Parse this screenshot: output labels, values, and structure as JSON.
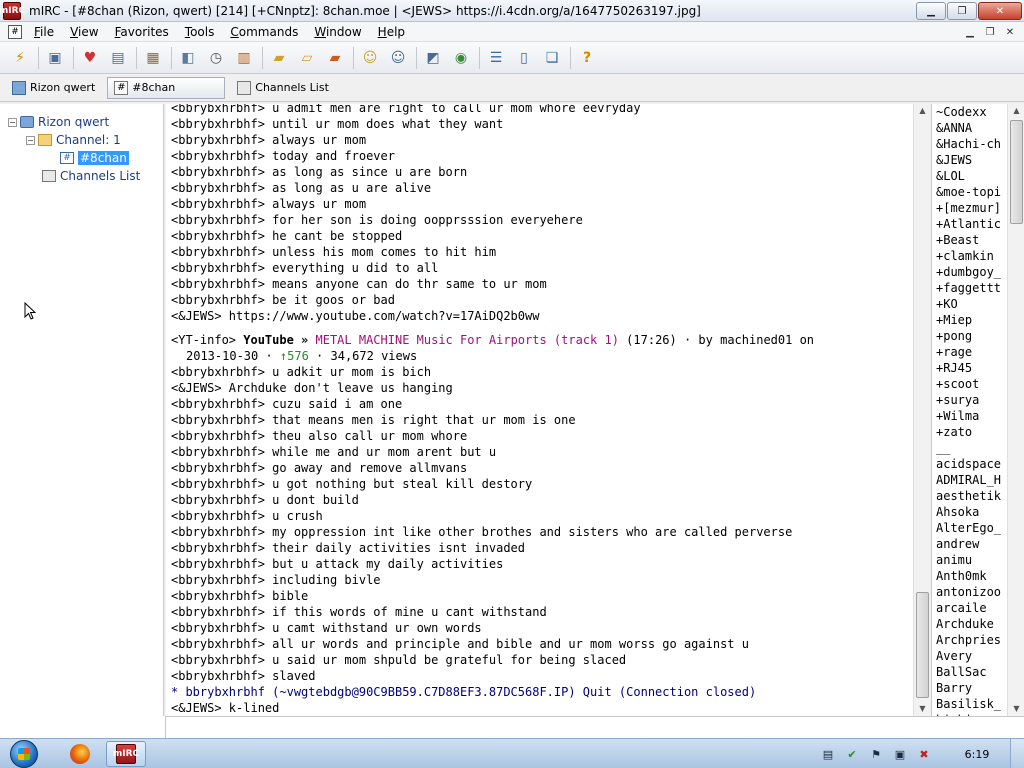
{
  "window": {
    "title": "mIRC - [#8chan (Rizon, qwert) [214] [+CNnptz]: 8chan.moe | <JEWS> https://i.4cdn.org/a/1647750263197.jpg]",
    "app_icon_text": "mIRC"
  },
  "menu": {
    "icon": "#",
    "items": [
      {
        "accel": "F",
        "rest": "ile"
      },
      {
        "accel": "V",
        "rest": "iew"
      },
      {
        "accel": "F",
        "rest": "avorites"
      },
      {
        "accel": "T",
        "rest": "ools"
      },
      {
        "accel": "C",
        "rest": "ommands"
      },
      {
        "accel": "W",
        "rest": "indow"
      },
      {
        "accel": "H",
        "rest": "elp"
      }
    ]
  },
  "switchbar": {
    "tabs": [
      {
        "label": "Rizon qwert",
        "icon": "network-icon"
      },
      {
        "label": "#8chan",
        "icon": "channel-icon",
        "active": true
      },
      {
        "label": "Channels List",
        "icon": "list-icon"
      }
    ]
  },
  "tree": {
    "network": "Rizon qwert",
    "folder": "Channel: 1",
    "channel": "#8chan",
    "channels_list": "Channels List",
    "chan_icon_glyph": "#"
  },
  "chat": {
    "lines": [
      "<bbrybxhrbhf> u admit men are right to call ur mom whore eevryday",
      "<bbrybxhrbhf> until ur mom does what they want",
      "<bbrybxhrbhf> always ur mom",
      "<bbrybxhrbhf> today and froever",
      "<bbrybxhrbhf> as long as since u are born",
      "<bbrybxhrbhf> as long as u are alive",
      "<bbrybxhrbhf> always ur mom",
      "<bbrybxhrbhf> for her son is doing oopprsssion everyehere",
      "<bbrybxhrbhf> he cant be stopped",
      "<bbrybxhrbhf> unless his mom comes to hit him",
      "<bbrybxhrbhf> everything u did to all",
      "<bbrybxhrbhf> means anyone can do thr same to ur mom",
      "<bbrybxhrbhf> be it goos or bad",
      "<&JEWS> https://www.youtube.com/watch?v=17AiDQ2b0ww"
    ],
    "yt": {
      "prefix": "<YT-info> ",
      "brand": "YouTube »",
      "title": " METAL MACHINE Music For Airports (track 1)",
      "meta": " (17:26) · by machined01 on",
      "date": "2013-10-30 · ",
      "likes": "↑576",
      "views": " · 34,672 views"
    },
    "lines2": [
      "<bbrybxhrbhf> u adkit ur mom is bich",
      "<&JEWS> Archduke don't leave us hanging",
      "<bbrybxhrbhf> cuzu said i am one",
      "<bbrybxhrbhf> that means men is right that ur mom is one",
      "<bbrybxhrbhf> theu also call ur mom whore",
      "<bbrybxhrbhf> while me and ur mom arent but u",
      "<bbrybxhrbhf> go away and remove allmvans",
      "<bbrybxhrbhf> u got nothing but steal kill destory",
      "<bbrybxhrbhf> u dont build",
      "<bbrybxhrbhf> u crush",
      "<bbrybxhrbhf> my oppression int like other brothes and sisters who are called perverse",
      "<bbrybxhrbhf> their daily activities isnt invaded",
      "<bbrybxhrbhf> but u attack my daily activities",
      "<bbrybxhrbhf> including bivle",
      "<bbrybxhrbhf> bible",
      "<bbrybxhrbhf> if this words of mine u cant withstand",
      "<bbrybxhrbhf> u camt withstand ur own words",
      "<bbrybxhrbhf> all ur words and principle and bible and ur mom worss go against u",
      "<bbrybxhrbhf> u said ur mom shpuld be grateful for being slaced",
      "<bbrybxhrbhf> slaved"
    ],
    "quit_line": "* bbrybxhrbhf (~vwgtebdgb@90C9BB59.C7D88EF3.87DC568F.IP) Quit (Connection closed)",
    "last_line": "<&JEWS> k-lined"
  },
  "nicklist": [
    "~Codexx",
    "&ANNA",
    "&Hachi-ch",
    "&JEWS",
    "&LOL",
    "&moe-topi",
    "+[mezmur]",
    "+Atlantic",
    "+Beast",
    "+clamkin",
    "+dumbgoy_",
    "+faggettt",
    "+KO",
    "+Miep",
    "+pong",
    "+rage",
    "+RJ45",
    "+scoot",
    "+surya",
    "+Wilma",
    "+zato",
    "__",
    "acidspace",
    "ADMIRAL_H",
    "aesthetik",
    "Ahsoka",
    "AlterEgo_",
    "andrew",
    "animu",
    "Anth0mk",
    "antonizoo",
    "arcaile",
    "Archduke",
    "Archpries",
    "Avery",
    "BallSac",
    "Barry",
    "Basilisk_",
    "binbi"
  ],
  "input": {
    "value": ""
  },
  "taskbar": {
    "clock": "6:19"
  }
}
